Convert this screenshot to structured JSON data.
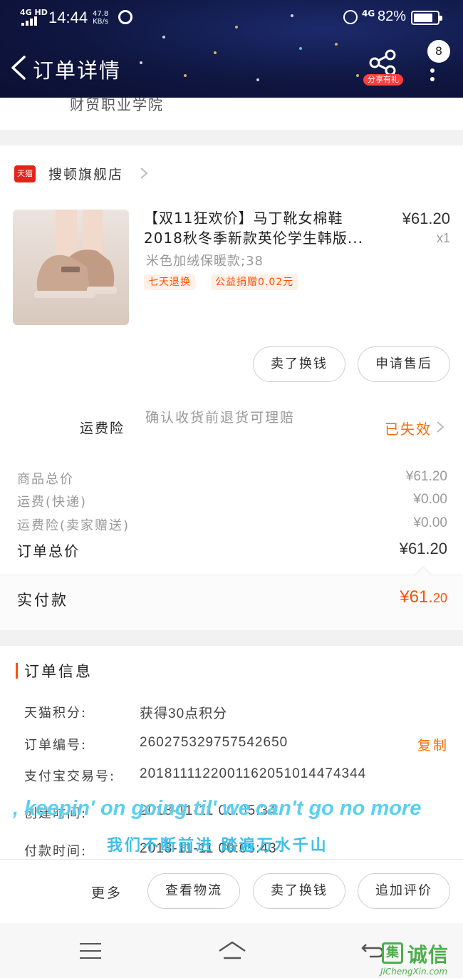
{
  "status_bar": {
    "network": "4G HD",
    "time": "14:44",
    "speed_value": "47.8",
    "speed_unit": "KB/s",
    "network_right": "4G",
    "battery": "82%",
    "battery_level": 0.82
  },
  "header": {
    "title": "订单详情",
    "share_label": "分享有礼",
    "message_count": "8"
  },
  "address": {
    "partial_text": "财贸职业学院"
  },
  "shop": {
    "icon_label": "天猫",
    "name": "搜顿旗舰店"
  },
  "product": {
    "title_line1": "【双11狂欢价】马丁靴女棉鞋",
    "title_line2": "2018秋冬季新款英伦学生韩版...",
    "price": "¥61.20",
    "quantity": "x1",
    "sku": "米色加绒保暖款;38",
    "tags": [
      "七天退换",
      "公益捐赠0.02元"
    ]
  },
  "item_actions": {
    "sell_label": "卖了换钱",
    "after_sale_label": "申请售后"
  },
  "insurance": {
    "label": "运费险",
    "desc": "确认收货前退货可理赔",
    "status": "已失效"
  },
  "costs": {
    "goods_total_label": "商品总价",
    "goods_total_value": "¥61.20",
    "shipping_label": "运费(快递)",
    "shipping_value": "¥0.00",
    "insurance_label": "运费险(卖家赠送)",
    "insurance_value": "¥0.00",
    "order_total_label": "订单总价",
    "order_total_value": "¥61.20",
    "paid_label": "实付款",
    "paid_value_int": "¥61.",
    "paid_value_dec": "20"
  },
  "order_info": {
    "section_title": "订单信息",
    "points_label": "天猫积分:",
    "points_value": "获得30点积分",
    "order_no_label": "订单编号:",
    "order_no_value": "260275329757542650",
    "copy_label": "复制",
    "alipay_label": "支付宝交易号:",
    "alipay_value": "2018111122001162051014474344",
    "created_label": "创建时间:",
    "created_value": "2018-11-11 00:05:34",
    "paid_time_label": "付款时间:",
    "paid_time_value": "2018-11-11 00:05:43"
  },
  "overlay": {
    "subtitle_en": ", keepin' on going til' we can't go no more",
    "subtitle_cn": "我们不断前进 踏遍万水千山"
  },
  "bottom_actions": {
    "more_label": "更多",
    "logistics_label": "查看物流",
    "sell_label": "卖了换钱",
    "review_label": "追加评价"
  },
  "watermark": {
    "box_char": "集",
    "text": "诚信",
    "url": "JiChengXin.com"
  },
  "colors": {
    "accent": "#ff5000",
    "header_bg": "#0f1640",
    "tmall_red": "#e5231b",
    "subtitle": "#5ad0f0"
  }
}
